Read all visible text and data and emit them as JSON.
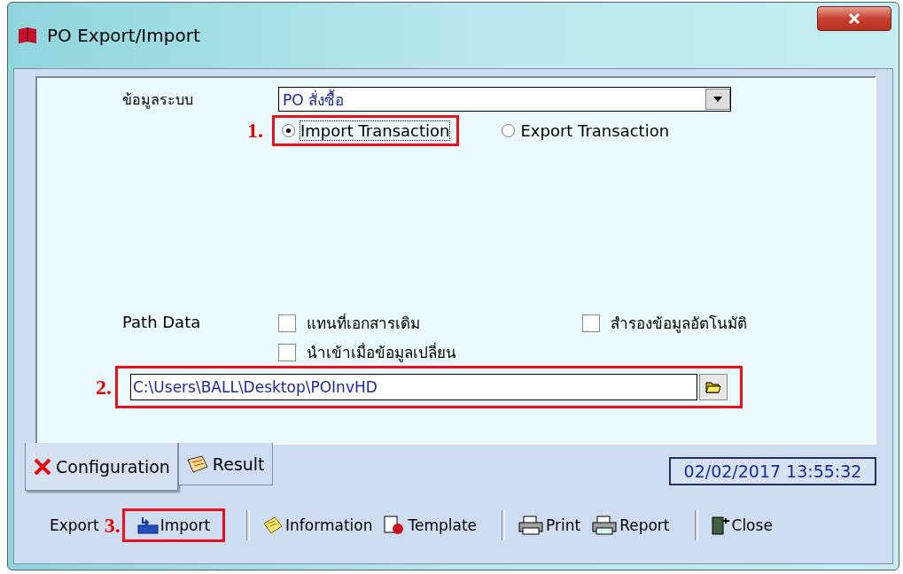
{
  "window": {
    "title": "PO Export/Import"
  },
  "system": {
    "label": "ข้อมูลระบบ",
    "value": "PO สั่งซื้อ"
  },
  "mode": {
    "annotation": "1.",
    "options": [
      {
        "label": "Import Transaction",
        "selected": true
      },
      {
        "label": "Export Transaction",
        "selected": false
      }
    ]
  },
  "path": {
    "label": "Path Data",
    "checkboxes": [
      {
        "label": "แทนที่เอกสารเดิม",
        "checked": false
      },
      {
        "label": "สำรองข้อมูลอัตโนมัติ",
        "checked": false
      },
      {
        "label": "นำเข้าเมื่อข้อมูลเปลี่ยน",
        "checked": false
      }
    ],
    "annotation": "2.",
    "value": "C:\\Users\\BALL\\Desktop\\POInvHD"
  },
  "tabs": [
    {
      "label": "Configuration",
      "kind": "config",
      "selected": true
    },
    {
      "label": "Result",
      "kind": "result",
      "selected": false
    }
  ],
  "datetime": "02/02/2017 13:55:32",
  "toolbar": [
    {
      "kind": "text",
      "label": "Export"
    },
    {
      "kind": "import",
      "label": "Import",
      "annotation": "3."
    },
    {
      "kind": "sep"
    },
    {
      "kind": "info",
      "label": "Information"
    },
    {
      "kind": "template",
      "label": "Template"
    },
    {
      "kind": "sep"
    },
    {
      "kind": "print",
      "label": "Print"
    },
    {
      "kind": "report",
      "label": "Report"
    },
    {
      "kind": "sep"
    },
    {
      "kind": "close",
      "label": "Close"
    }
  ]
}
